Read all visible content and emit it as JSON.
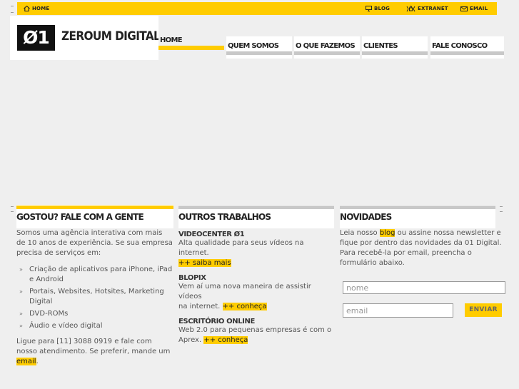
{
  "topbar": {
    "home": "HOME",
    "blog": "BLOG",
    "extranet": "EXTRANET",
    "email": "EMAIL"
  },
  "logo": {
    "mark": "Ø1",
    "name": "ZEROUM DIGITAL"
  },
  "nav": [
    {
      "label": "HOME"
    },
    {
      "label": "QUEM SOMOS"
    },
    {
      "label": "O QUE FAZEMOS"
    },
    {
      "label": "CLIENTES"
    },
    {
      "label": "FALE CONOSCO"
    }
  ],
  "contact": {
    "title": "GOSTOU? FALE COM A GENTE",
    "intro": "Somos uma agência interativa com mais de 10 anos de experiência. Se sua empresa precisa de serviços em:",
    "services": [
      "Criação de aplicativos para iPhone, iPad e Android",
      "Portais, Websites, Hotsites, Marketing Digital",
      "DVD-ROMs",
      "Áudio e vídeo digital"
    ],
    "outro": "Ligue para [11] 3088 0919 e fale com nosso atendimento. Se preferir, mande um",
    "email_link": "email",
    "outro_end": "."
  },
  "works": {
    "title": "OUTROS TRABALHOS",
    "projects": [
      {
        "name": "VIDEOCENTER Ø1",
        "desc": "Alta qualidade para seus vídeos na internet.",
        "link": "++ saiba mais"
      },
      {
        "name": "BLOPIX",
        "desc": "Vem aí uma nova maneira de assistir vídeos",
        "desc2": "na internet.",
        "link": "++ conheça"
      },
      {
        "name": "ESCRITÓRIO ONLINE",
        "desc": "Web 2.0 para pequenas empresas é com o Aprex.",
        "link": "++ conheça"
      }
    ]
  },
  "news": {
    "title": "NOVIDADES",
    "text_before": "Leia nosso",
    "blog_link": "blog",
    "text_after": "ou assine nossa newsletter e fique por dentro das novidades da 01 Digital. Para recebê-la por email, preencha o formulário abaixo.",
    "name_placeholder": "nome",
    "email_placeholder": "email",
    "send": "ENVIAR"
  },
  "colors": {
    "accent": "#ffcc00",
    "background": "#efefef",
    "bar_gray": "#c8c8c8"
  }
}
